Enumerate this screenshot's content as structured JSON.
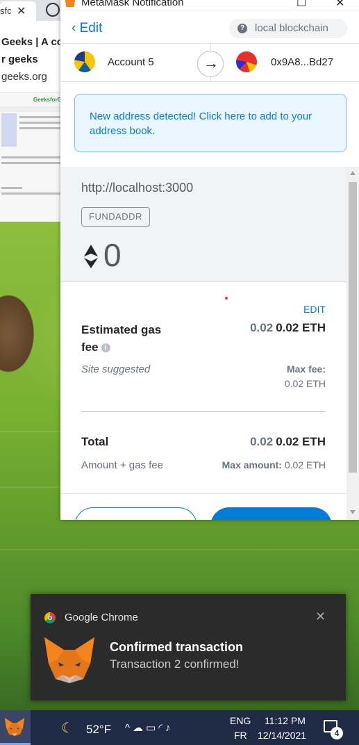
{
  "background_browser": {
    "tab_label": "sfc",
    "article_title_line1": "Geeks | A co",
    "article_title_line2": "r geeks",
    "site_url": "geeks.org",
    "thumbnail_brand": "GeeksforGeeks"
  },
  "metamask_window": {
    "title": "MetaMask Notification",
    "header": {
      "back_label": "Edit",
      "network": "local blockchain"
    },
    "accounts": {
      "from": "Account 5",
      "to": "0x9A8...Bd27"
    },
    "notice": "New address detected! Click here to add to your address book.",
    "site": {
      "origin": "http://localhost:3000",
      "method": "FUNDADDR",
      "amount": "0"
    },
    "gas": {
      "edit_label": "EDIT",
      "label": "Estimated gas fee",
      "secondary_value": "0.02",
      "primary_value": "0.02 ETH",
      "site_suggested": "Site suggested",
      "max_fee_label": "Max fee:",
      "max_fee_value": "0.02 ETH"
    },
    "total": {
      "label": "Total",
      "secondary_value": "0.02",
      "primary_value": "0.02 ETH",
      "sub_label": "Amount + gas fee",
      "max_amount_label": "Max amount:",
      "max_amount_value": "0.02 ETH"
    }
  },
  "toast": {
    "app": "Google Chrome",
    "title": "Confirmed transaction",
    "body": "Transaction 2 confirmed!"
  },
  "taskbar": {
    "temperature": "52°F",
    "lang_line1": "ENG",
    "lang_line2": "FR",
    "time": "11:12 PM",
    "date": "12/14/2021",
    "notification_count": "4"
  },
  "colors": {
    "metamask_blue": "#037dd6",
    "metamask_orange": "#f5841f",
    "taskbar": "#1f2a44",
    "toast_bg": "#2b2b2b"
  }
}
